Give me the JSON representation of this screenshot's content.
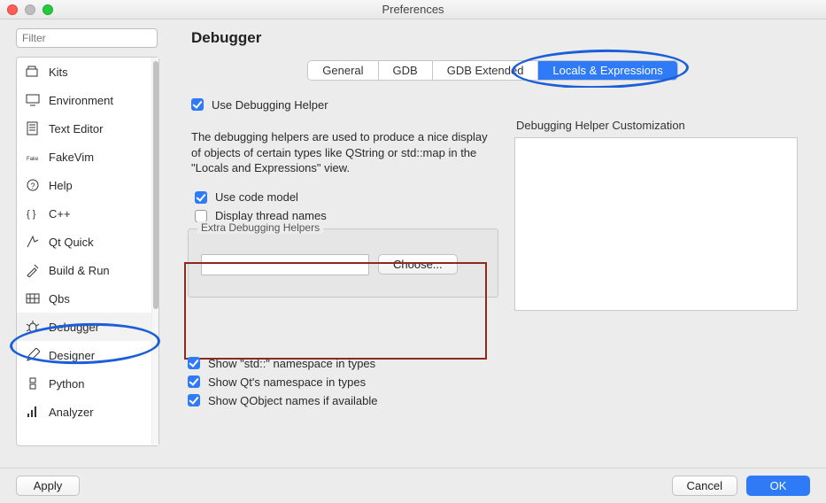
{
  "window": {
    "title": "Preferences"
  },
  "filter": {
    "placeholder": "Filter"
  },
  "page": {
    "title": "Debugger"
  },
  "sidebar": {
    "items": [
      {
        "label": "Kits"
      },
      {
        "label": "Environment"
      },
      {
        "label": "Text Editor"
      },
      {
        "label": "FakeVim"
      },
      {
        "label": "Help"
      },
      {
        "label": "C++"
      },
      {
        "label": "Qt Quick"
      },
      {
        "label": "Build & Run"
      },
      {
        "label": "Qbs"
      },
      {
        "label": "Debugger"
      },
      {
        "label": "Designer"
      },
      {
        "label": "Python"
      },
      {
        "label": "Analyzer"
      }
    ],
    "selected_index": 9
  },
  "tabs": {
    "items": [
      "General",
      "GDB",
      "GDB Extended",
      "Locals & Expressions"
    ],
    "active_index": 3
  },
  "panel": {
    "use_helper_label": "Use Debugging Helper",
    "desc": "The debugging helpers are used to produce a nice display of objects of certain types like QString or std::map in the \"Locals and Expressions\" view.",
    "use_code_model_label": "Use code model",
    "display_thread_names_label": "Display thread names",
    "extra_helpers_title": "Extra Debugging Helpers",
    "choose_label": "Choose...",
    "extra_helpers_value": "",
    "custom_title": "Debugging Helper Customization"
  },
  "below": {
    "show_std_label": "Show \"std::\" namespace in types",
    "show_qt_label": "Show Qt's namespace in types",
    "show_qobj_label": "Show QObject names if available"
  },
  "footer": {
    "apply": "Apply",
    "cancel": "Cancel",
    "ok": "OK"
  }
}
